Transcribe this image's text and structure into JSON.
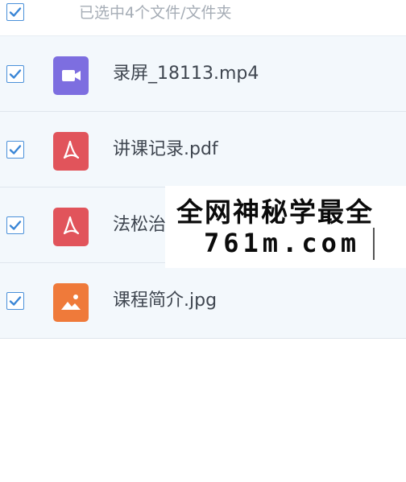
{
  "header": {
    "select_all_checked": true,
    "summary": "已选中4个文件/文件夹"
  },
  "files": [
    {
      "name": "录屏_18113.mp4",
      "type": "video",
      "icon": "video-file-icon",
      "checked": true
    },
    {
      "name": "讲课记录.pdf",
      "type": "pdf",
      "icon": "pdf-file-icon",
      "checked": true
    },
    {
      "name": "法松治",
      "type": "pdf",
      "icon": "pdf-file-icon",
      "checked": true
    },
    {
      "name": "课程简介.jpg",
      "type": "image",
      "icon": "image-file-icon",
      "checked": true
    }
  ],
  "watermark": {
    "line1": "全网神秘学最全",
    "line2": "761m.com"
  },
  "colors": {
    "checkbox": "#4a90d9",
    "video": "#7d6ee0",
    "pdf": "#e1545b",
    "image": "#ef7a3a",
    "row_bg": "#f3f8fc"
  }
}
